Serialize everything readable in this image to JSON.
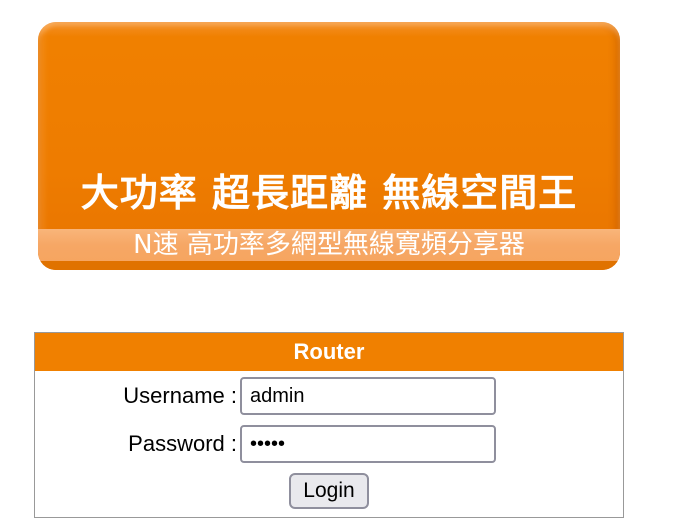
{
  "banner": {
    "headline": "大功率  超長距離  無線空間王",
    "subtitle": "N速 高功率多網型無線寬頻分享器",
    "brand_color": "#f08000"
  },
  "login": {
    "title": "Router",
    "username_label": "Username :",
    "username_value": "admin",
    "password_label": "Password :",
    "password_value": "admin",
    "submit_label": "Login"
  }
}
